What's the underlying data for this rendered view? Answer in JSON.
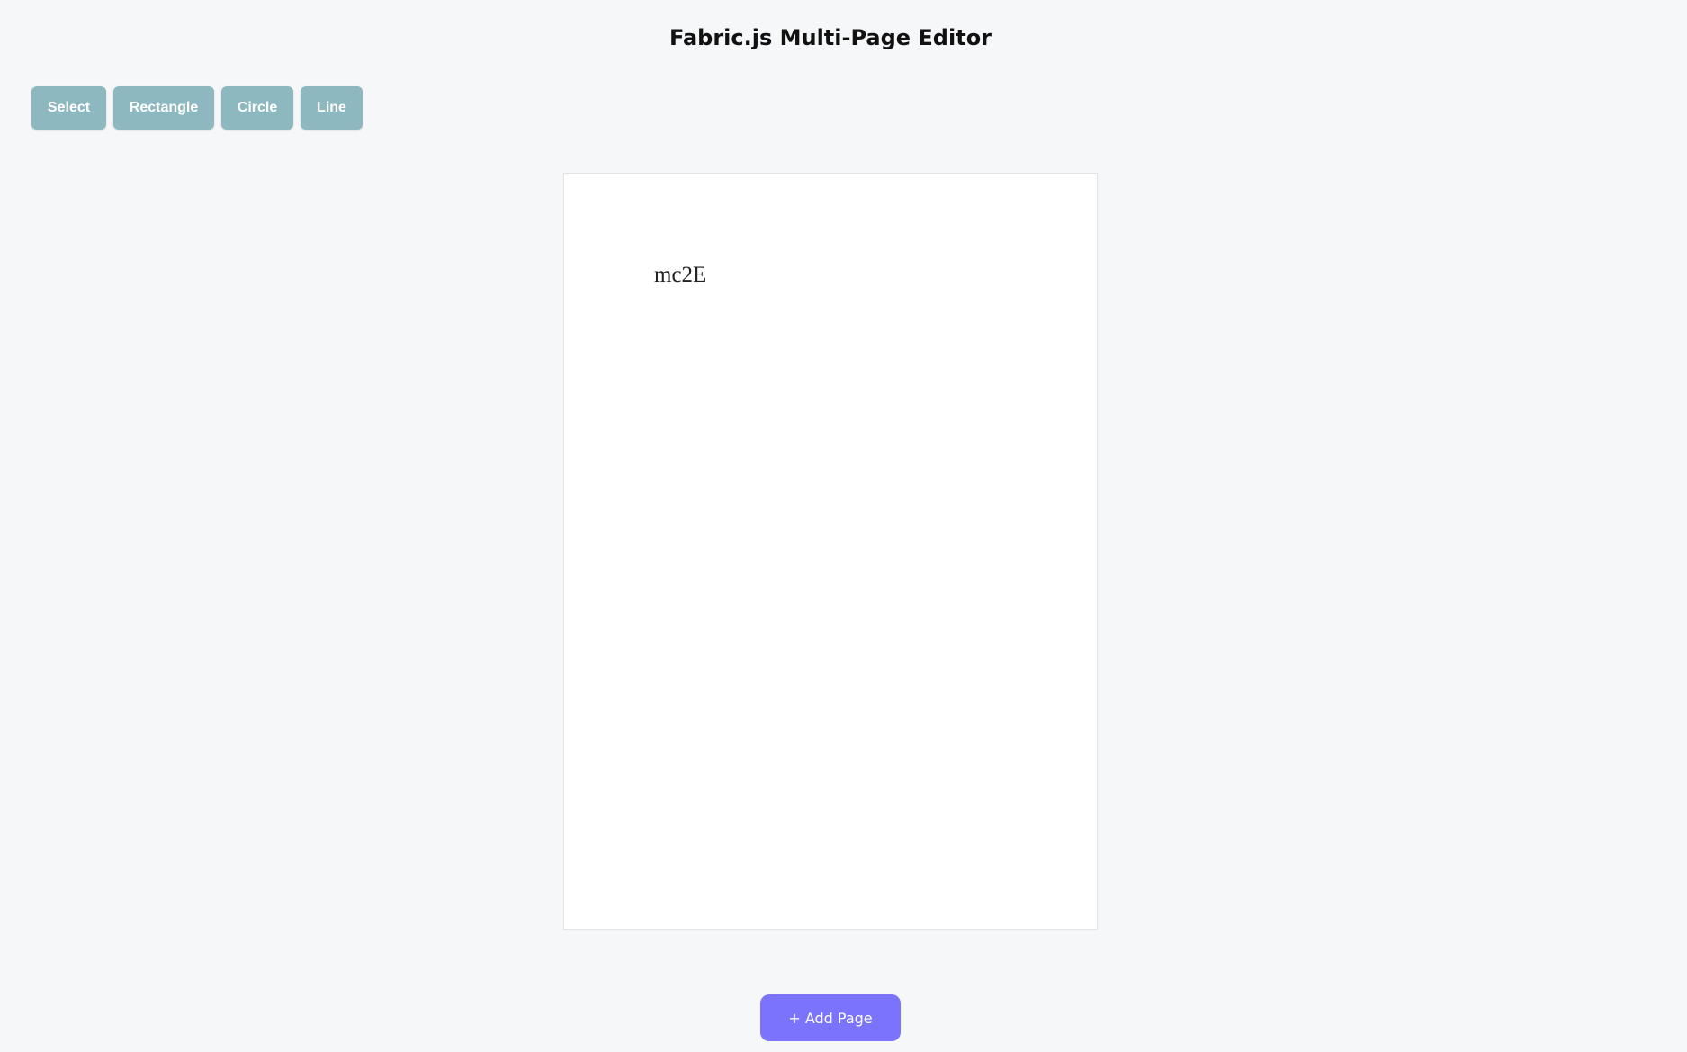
{
  "header": {
    "title": "Fabric.js Multi-Page Editor"
  },
  "toolbar": {
    "tools": [
      {
        "label": "Select"
      },
      {
        "label": "Rectangle"
      },
      {
        "label": "Circle"
      },
      {
        "label": "Line"
      }
    ]
  },
  "page": {
    "text_object": "mc2E"
  },
  "footer": {
    "add_page_label": "+ Add Page"
  },
  "colors": {
    "background": "#f6f7f9",
    "tool_button": "#8db8c0",
    "add_page_button": "#7b73fb",
    "page": "#ffffff"
  }
}
